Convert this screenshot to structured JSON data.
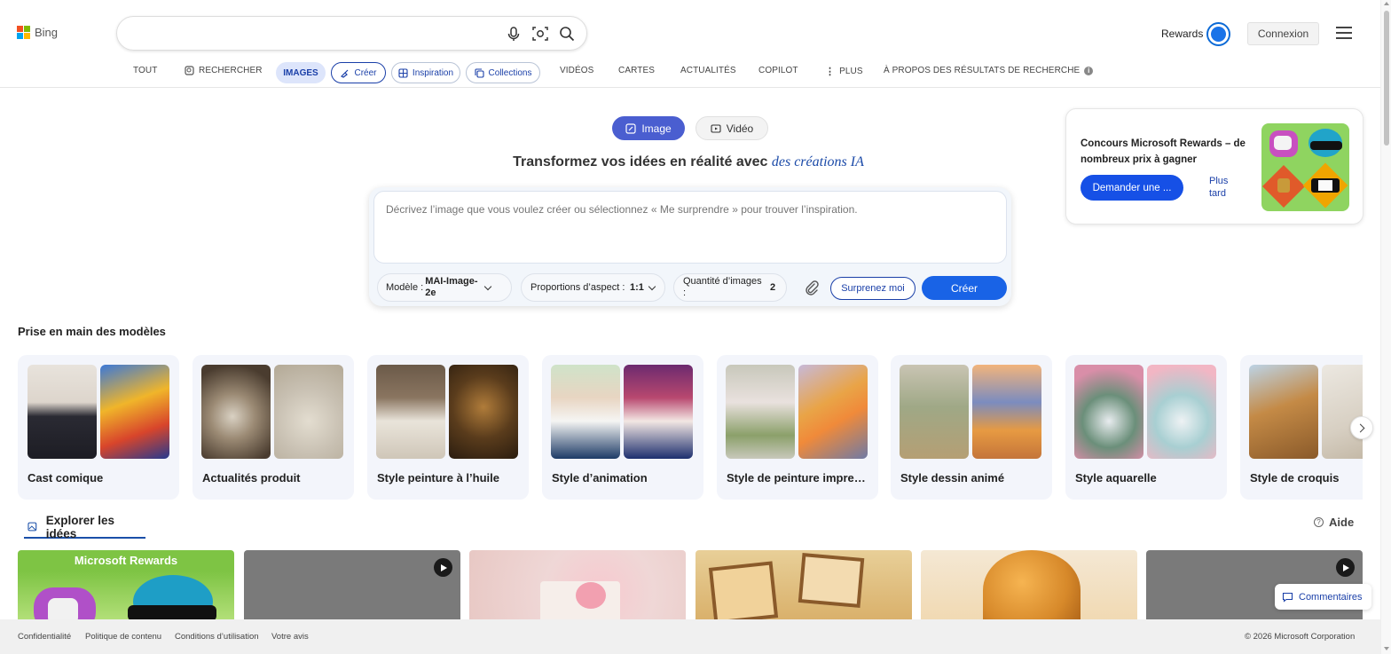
{
  "header": {
    "logo_text": "Bing",
    "search": {
      "value": "",
      "placeholder": ""
    },
    "rewards_label": "Rewards",
    "connexion_label": "Connexion"
  },
  "nav": {
    "items": [
      "TOUT",
      "RECHERCHER",
      "IMAGES",
      "Créer",
      "Inspiration",
      "Collections",
      "VIDÉOS",
      "CARTES",
      "ACTUALITÉS",
      "COPILOT",
      "PLUS",
      "À PROPOS DES RÉSULTATS DE RECHERCHE"
    ],
    "active": "IMAGES"
  },
  "mode": {
    "image_label": "Image",
    "video_label": "Vidéo",
    "selected": "Image"
  },
  "headline": {
    "text": "Transformez vos idées en réalité avec ",
    "accent": "des créations IA"
  },
  "prompt": {
    "placeholder": "Décrivez l’image que vous voulez créer ou sélectionnez « Me surprendre » pour trouver l’inspiration.",
    "value": "",
    "model_label": "Modèle :",
    "model_value": "MAI-Image-2e",
    "aspect_label": "Proportions d’aspect :",
    "aspect_value": "1:1",
    "quantity_label": "Quantité d’images :",
    "quantity_value": "2",
    "surprise_label": "Surprenez moi",
    "create_label": "Créer"
  },
  "promo": {
    "title": "Concours Microsoft Rewards – de nombreux prix à gagner",
    "cta_label": "Demander une ...",
    "later_label": "Plus tard"
  },
  "models": {
    "section_title": "Prise en main des modèles",
    "cards": [
      {
        "label": "Cast comique"
      },
      {
        "label": "Actualités produit"
      },
      {
        "label": "Style peinture à l’huile"
      },
      {
        "label": "Style d’animation"
      },
      {
        "label": "Style de peinture impre…"
      },
      {
        "label": "Style dessin animé"
      },
      {
        "label": "Style aquarelle"
      },
      {
        "label": "Style de croquis"
      }
    ]
  },
  "explore": {
    "tab_label": "Explorer les idées",
    "help_label": "Aide",
    "cards": [
      {
        "overlay_text": "Microsoft Rewards",
        "video": false
      },
      {
        "overlay_text": "",
        "video": true
      },
      {
        "overlay_text": "",
        "video": false
      },
      {
        "overlay_text": "",
        "video": false
      },
      {
        "overlay_text": "",
        "video": false
      },
      {
        "overlay_text": "",
        "video": true
      }
    ]
  },
  "feedback_label": "Commentaires",
  "footer": {
    "links": [
      "Confidentialité",
      "Politique de contenu",
      "Conditions d’utilisation",
      "Votre avis"
    ],
    "copyright": "© 2026 Microsoft Corporation"
  },
  "colors": {
    "accent": "#1963e6",
    "mode_active": "#4a5ed0",
    "link": "#1a3fa8",
    "nav_active_bg": "#dde5fb"
  }
}
